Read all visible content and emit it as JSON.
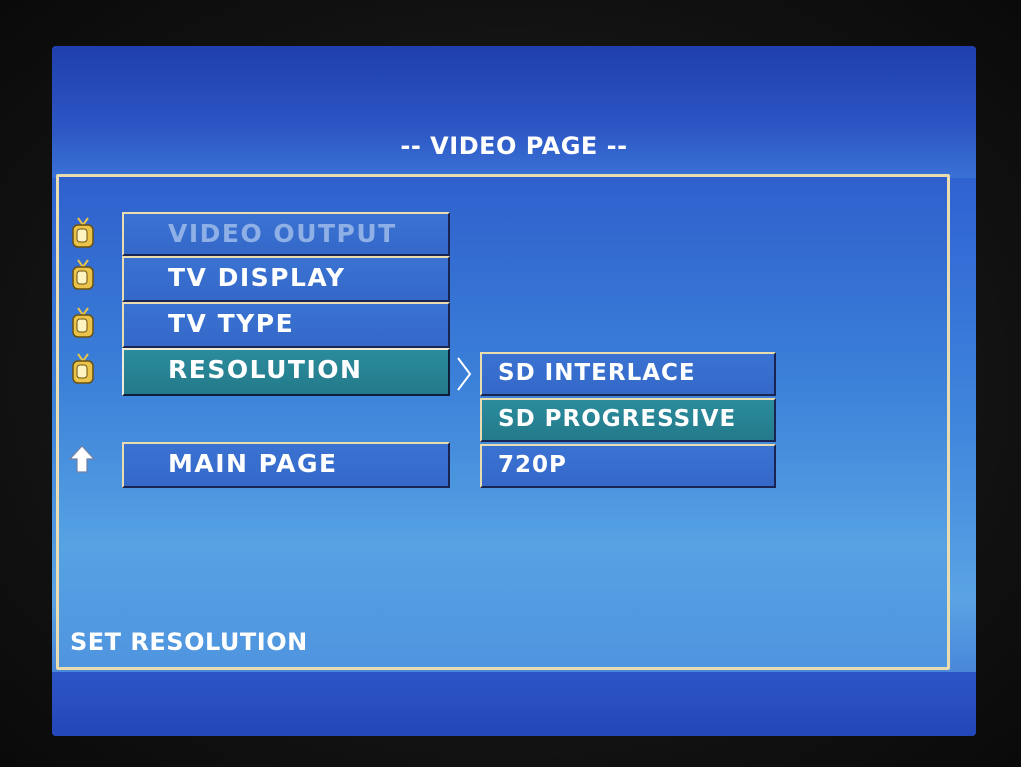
{
  "page": {
    "title": "-- VIDEO PAGE --"
  },
  "menu": {
    "items": [
      {
        "label": "VIDEO OUTPUT",
        "state": "disabled",
        "icon": "tv-icon"
      },
      {
        "label": "TV DISPLAY",
        "state": "normal",
        "icon": "tv-icon"
      },
      {
        "label": "TV TYPE",
        "state": "normal",
        "icon": "tv-icon"
      },
      {
        "label": "RESOLUTION",
        "state": "selected",
        "icon": "tv-icon"
      }
    ],
    "main_page": {
      "label": "MAIN PAGE",
      "icon": "up-arrow-icon"
    }
  },
  "submenu": {
    "indicator_icon": "chevron-right-icon",
    "options": [
      {
        "label": "SD INTERLACE",
        "state": "normal"
      },
      {
        "label": "SD PROGRESSIVE",
        "state": "highlighted"
      },
      {
        "label": "720P",
        "state": "normal"
      }
    ]
  },
  "status": {
    "text": "SET RESOLUTION"
  },
  "colors": {
    "screen_blue": "#3168d4",
    "panel_border": "#e8dcb0",
    "selection_teal": "#2b8c9c",
    "icon_gold": "#e9c34a",
    "text": "#ffffff"
  }
}
